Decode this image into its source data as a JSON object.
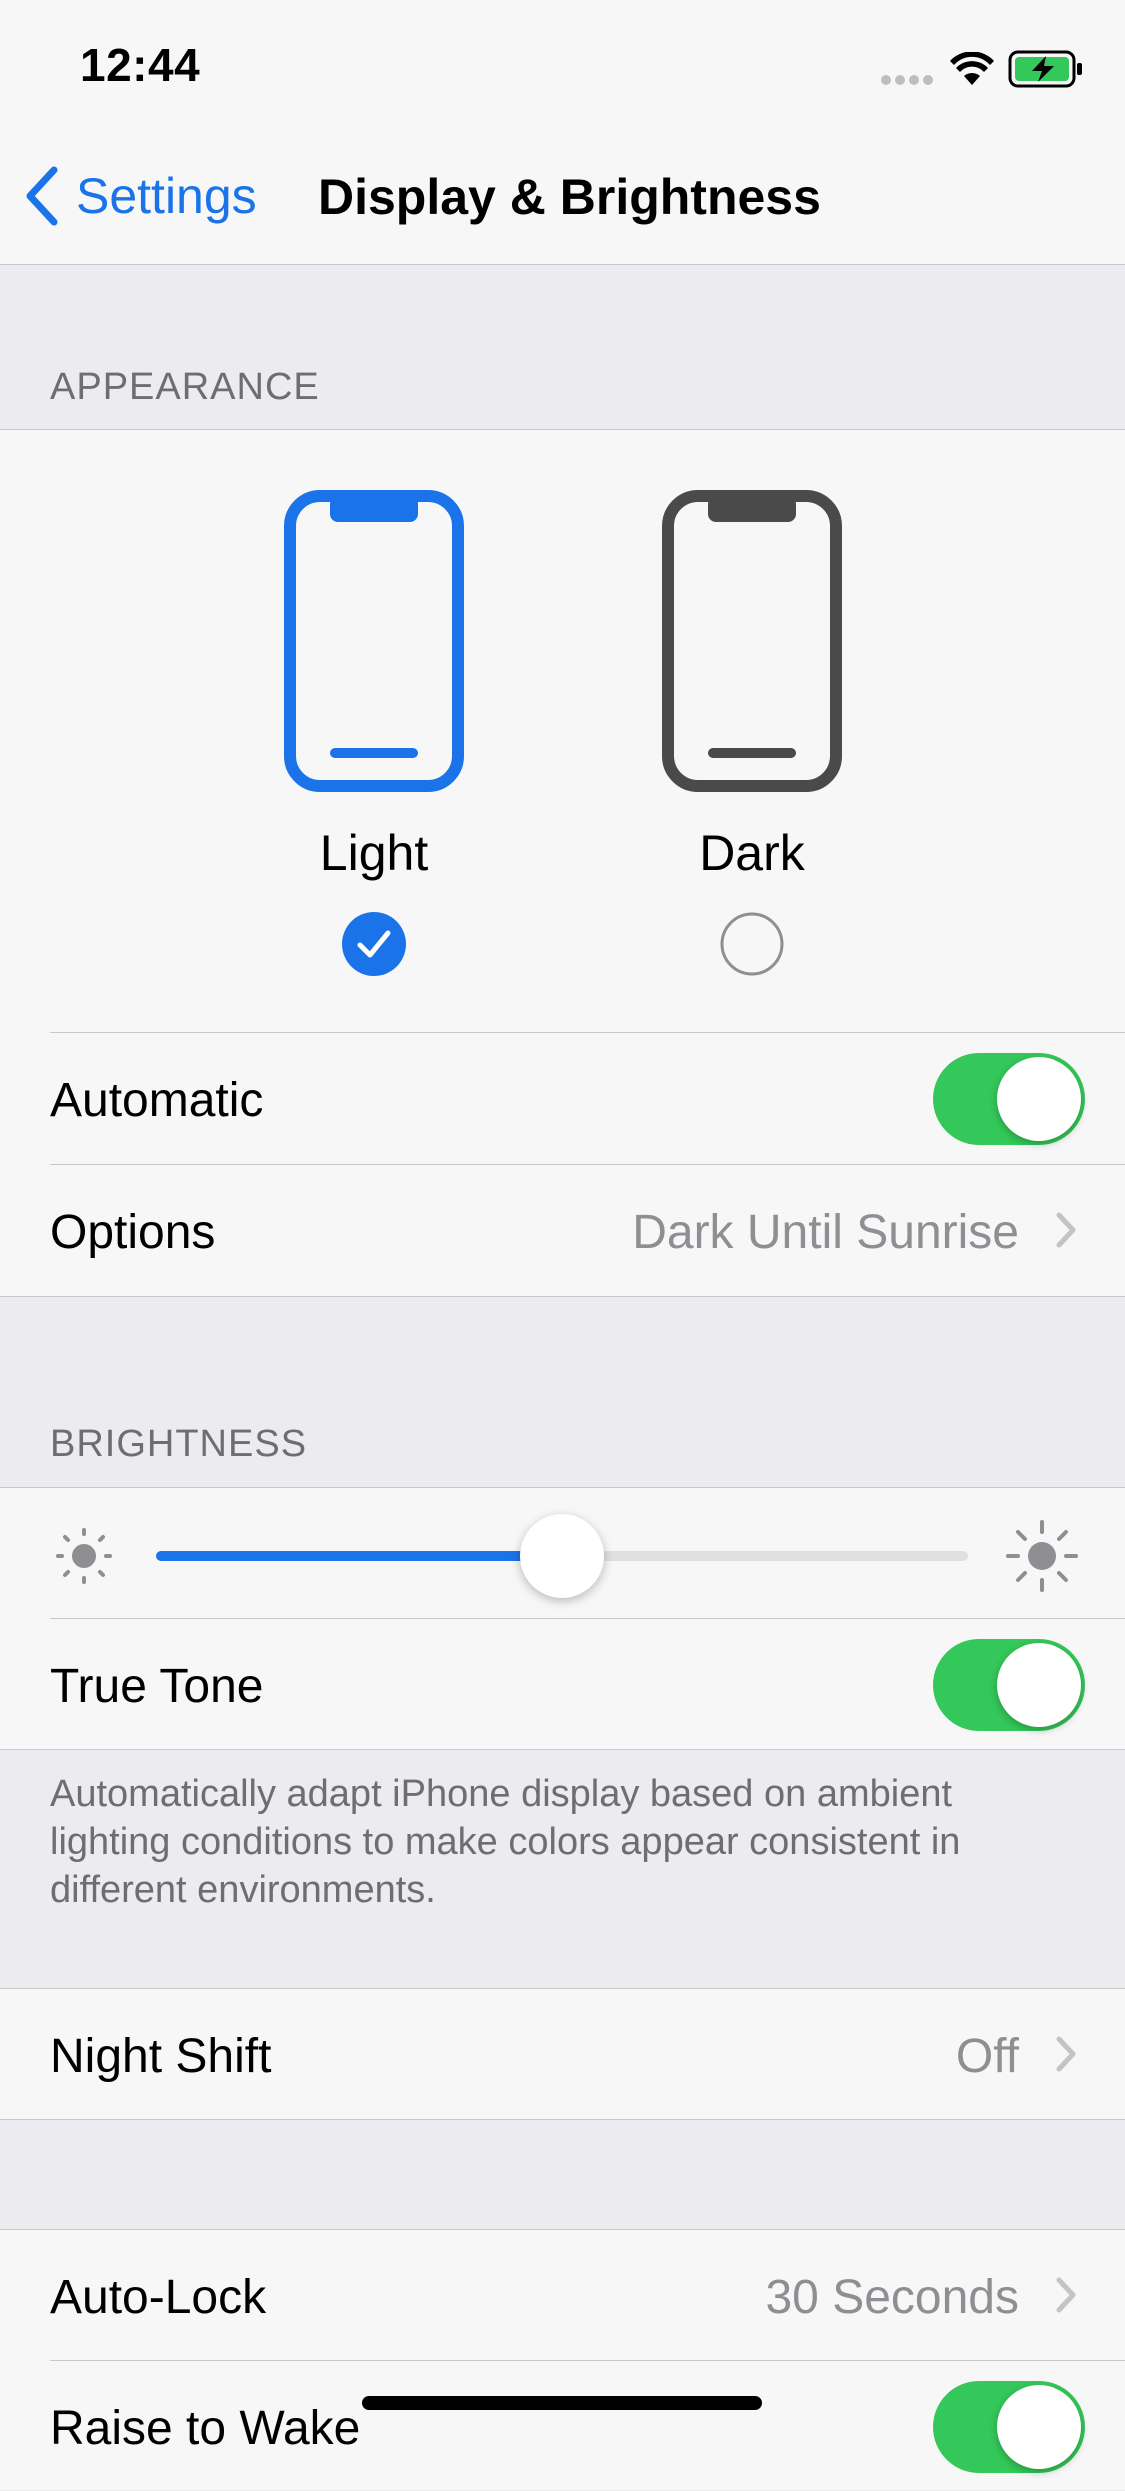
{
  "status_bar": {
    "time": "12:44",
    "icons": [
      "signal-dots-icon",
      "wifi-icon",
      "battery-charging-icon"
    ],
    "battery_color": "#34c759"
  },
  "nav": {
    "back_label": "Settings",
    "title": "Display & Brightness"
  },
  "appearance": {
    "header": "APPEARANCE",
    "options": [
      {
        "label": "Light",
        "selected": true
      },
      {
        "label": "Dark",
        "selected": false
      }
    ],
    "automatic_label": "Automatic",
    "automatic_on": true,
    "options_label": "Options",
    "options_value": "Dark Until Sunrise"
  },
  "brightness": {
    "header": "BRIGHTNESS",
    "level": 0.5,
    "true_tone_label": "True Tone",
    "true_tone_on": true,
    "footnote": "Automatically adapt iPhone display based on ambient lighting conditions to make colors appear consistent in different environments."
  },
  "night_shift": {
    "label": "Night Shift",
    "value": "Off"
  },
  "lock": {
    "auto_lock_label": "Auto-Lock",
    "auto_lock_value": "30 Seconds",
    "raise_to_wake_label": "Raise to Wake",
    "raise_to_wake_on": true
  },
  "colors": {
    "accent": "#1a73e8",
    "toggle_on": "#34c759",
    "dark_phone": "#4a4a4a"
  }
}
